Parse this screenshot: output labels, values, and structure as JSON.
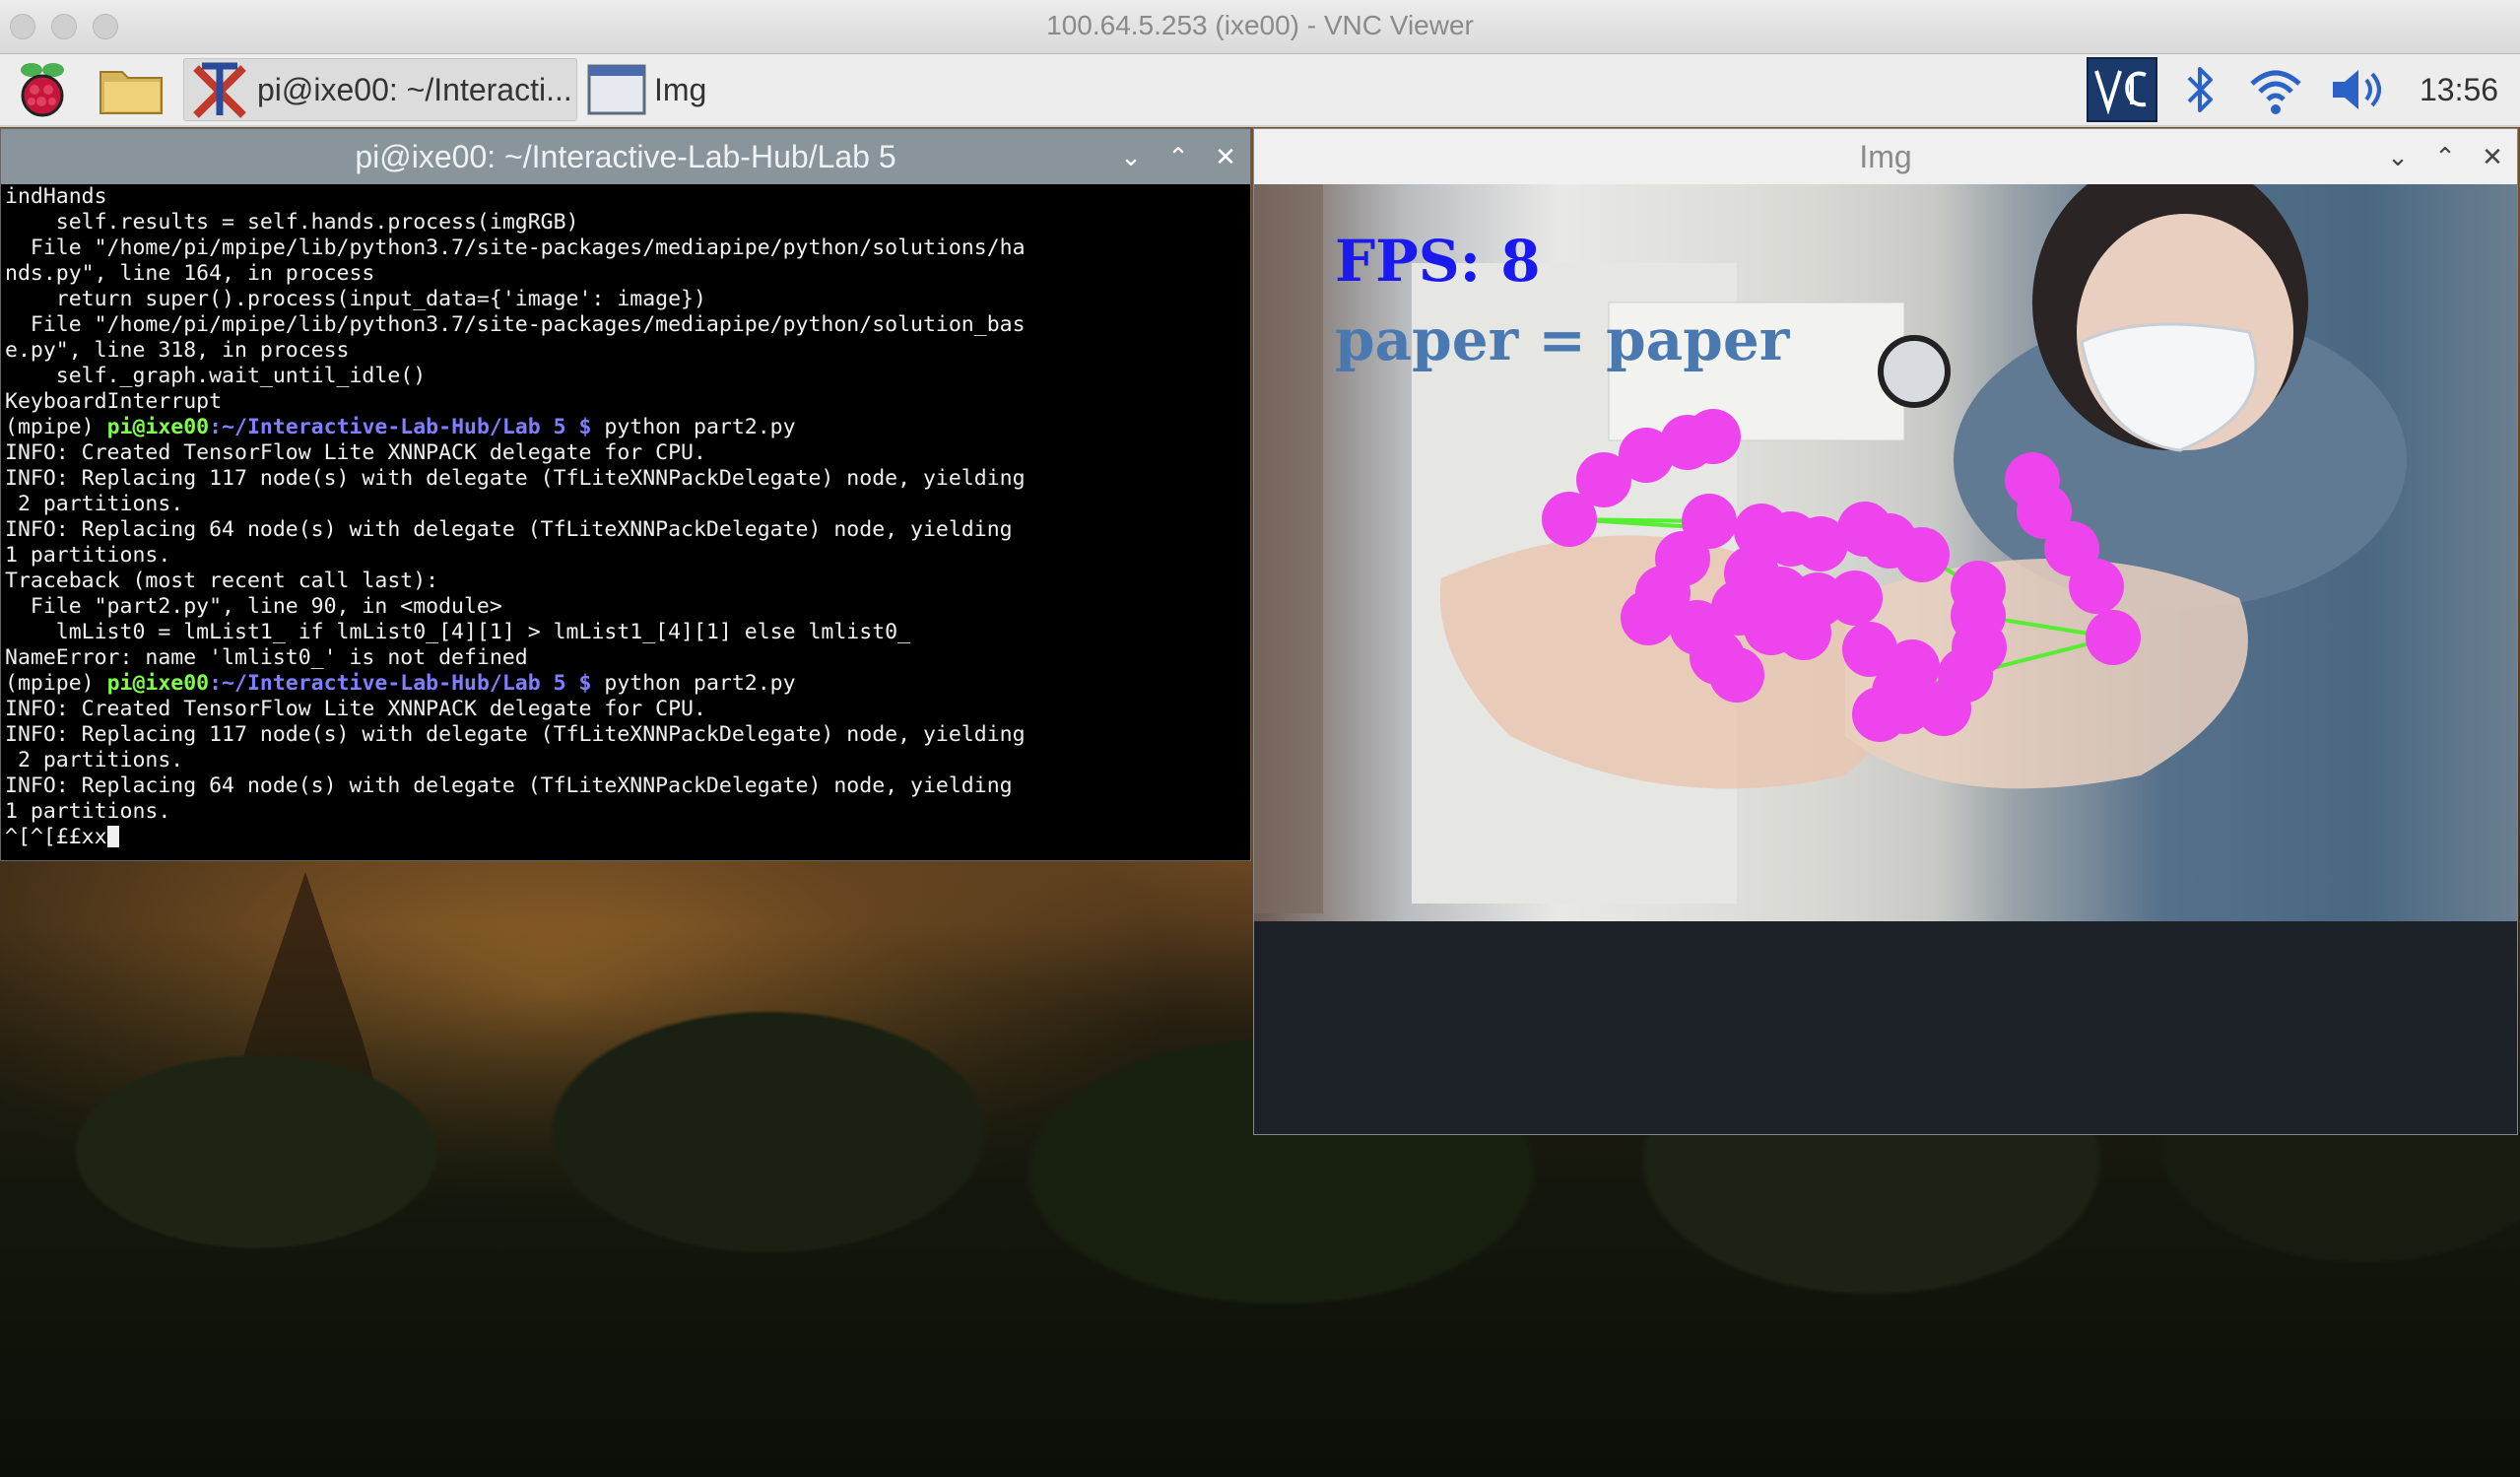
{
  "mac_window": {
    "title": "100.64.5.253 (ixe00) - VNC Viewer"
  },
  "taskbar": {
    "tasks": [
      {
        "label": "pi@ixe00: ~/Interacti..."
      },
      {
        "label": "Img"
      }
    ],
    "tray_icons": [
      "vnc-icon",
      "bluetooth-icon",
      "wifi-icon",
      "volume-icon"
    ],
    "clock": "13:56"
  },
  "terminal_window": {
    "title": "pi@ixe00: ~/Interactive-Lab-Hub/Lab 5",
    "lines": [
      "indHands",
      "    self.results = self.hands.process(imgRGB)",
      "  File \"/home/pi/mpipe/lib/python3.7/site-packages/mediapipe/python/solutions/ha",
      "nds.py\", line 164, in process",
      "    return super().process(input_data={'image': image})",
      "  File \"/home/pi/mpipe/lib/python3.7/site-packages/mediapipe/python/solution_bas",
      "e.py\", line 318, in process",
      "    self._graph.wait_until_idle()",
      "KeyboardInterrupt"
    ],
    "prompt_env": "(mpipe) ",
    "prompt_user": "pi@ixe00",
    "prompt_path": ":~/Interactive-Lab-Hub/Lab 5 $",
    "command": " python part2.py",
    "lines_2": [
      "INFO: Created TensorFlow Lite XNNPACK delegate for CPU.",
      "INFO: Replacing 117 node(s) with delegate (TfLiteXNNPackDelegate) node, yielding",
      " 2 partitions.",
      "INFO: Replacing 64 node(s) with delegate (TfLiteXNNPackDelegate) node, yielding",
      "1 partitions.",
      "Traceback (most recent call last):",
      "  File \"part2.py\", line 90, in <module>",
      "    lmList0 = lmList1_ if lmList0_[4][1] > lmList1_[4][1] else lmlist0_",
      "NameError: name 'lmlist0_' is not defined"
    ],
    "lines_3": [
      "INFO: Created TensorFlow Lite XNNPACK delegate for CPU.",
      "INFO: Replacing 117 node(s) with delegate (TfLiteXNNPackDelegate) node, yielding",
      " 2 partitions.",
      "INFO: Replacing 64 node(s) with delegate (TfLiteXNNPackDelegate) node, yielding",
      "1 partitions."
    ],
    "last_input": "^[^[££xx"
  },
  "img_window": {
    "title": "Img",
    "fps_text": "FPS: 8",
    "gesture_text": "paper = paper",
    "colors": {
      "landmark": "#ee44ee",
      "connection": "#55ee33",
      "fps": "#1a1aee",
      "gesture": "#4a78b0"
    }
  }
}
